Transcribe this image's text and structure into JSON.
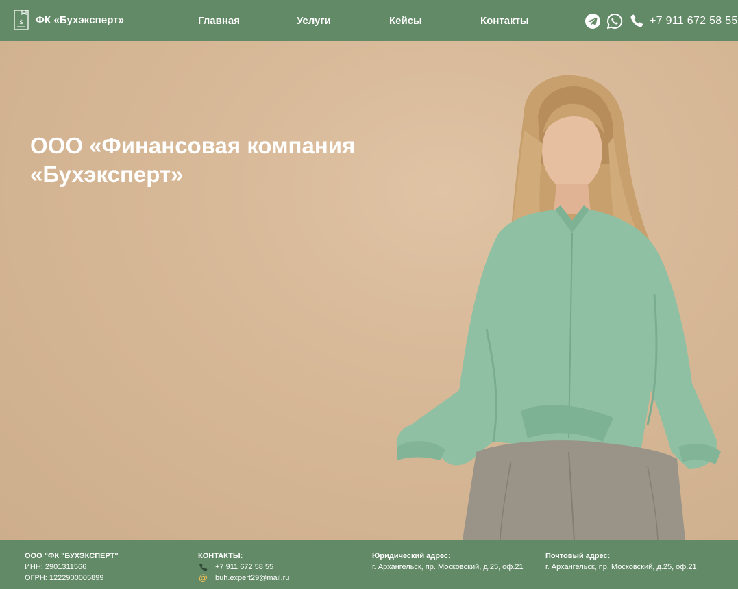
{
  "header": {
    "brand": "ФК «Бухэксперт»",
    "nav": [
      {
        "label": "Главная"
      },
      {
        "label": "Услуги"
      },
      {
        "label": "Кейсы"
      },
      {
        "label": "Контакты"
      }
    ],
    "social_icons": [
      "telegram-icon",
      "whatsapp-icon",
      "phone-icon"
    ],
    "phone": "+7 911 672 58 55"
  },
  "hero": {
    "title_line1": "ООО «Финансовая компания",
    "title_line2": "«Бухэксперт»"
  },
  "footer": {
    "company": {
      "name": "ООО \"ФК \"БУХЭКСПЕРТ\"",
      "inn": "ИНН: 2901311566",
      "ogrn": "ОГРН: 1222900005899"
    },
    "contacts": {
      "title": "КОНТАКТЫ:",
      "phone": "+7 911 672 58 55",
      "email": "buh.expert29@mail.ru"
    },
    "legal_address": {
      "title": "Юридический адрес:",
      "value": "г. Архангельск, пр. Московский, д.25, оф.21"
    },
    "postal_address": {
      "title": "Почтовый адрес:",
      "value": "г. Архангельск, пр. Московский, д.25, оф.21"
    }
  },
  "colors": {
    "brand_green": "#628a67",
    "background_beige": "#d7b898",
    "accent_yellow": "#f5c156"
  }
}
